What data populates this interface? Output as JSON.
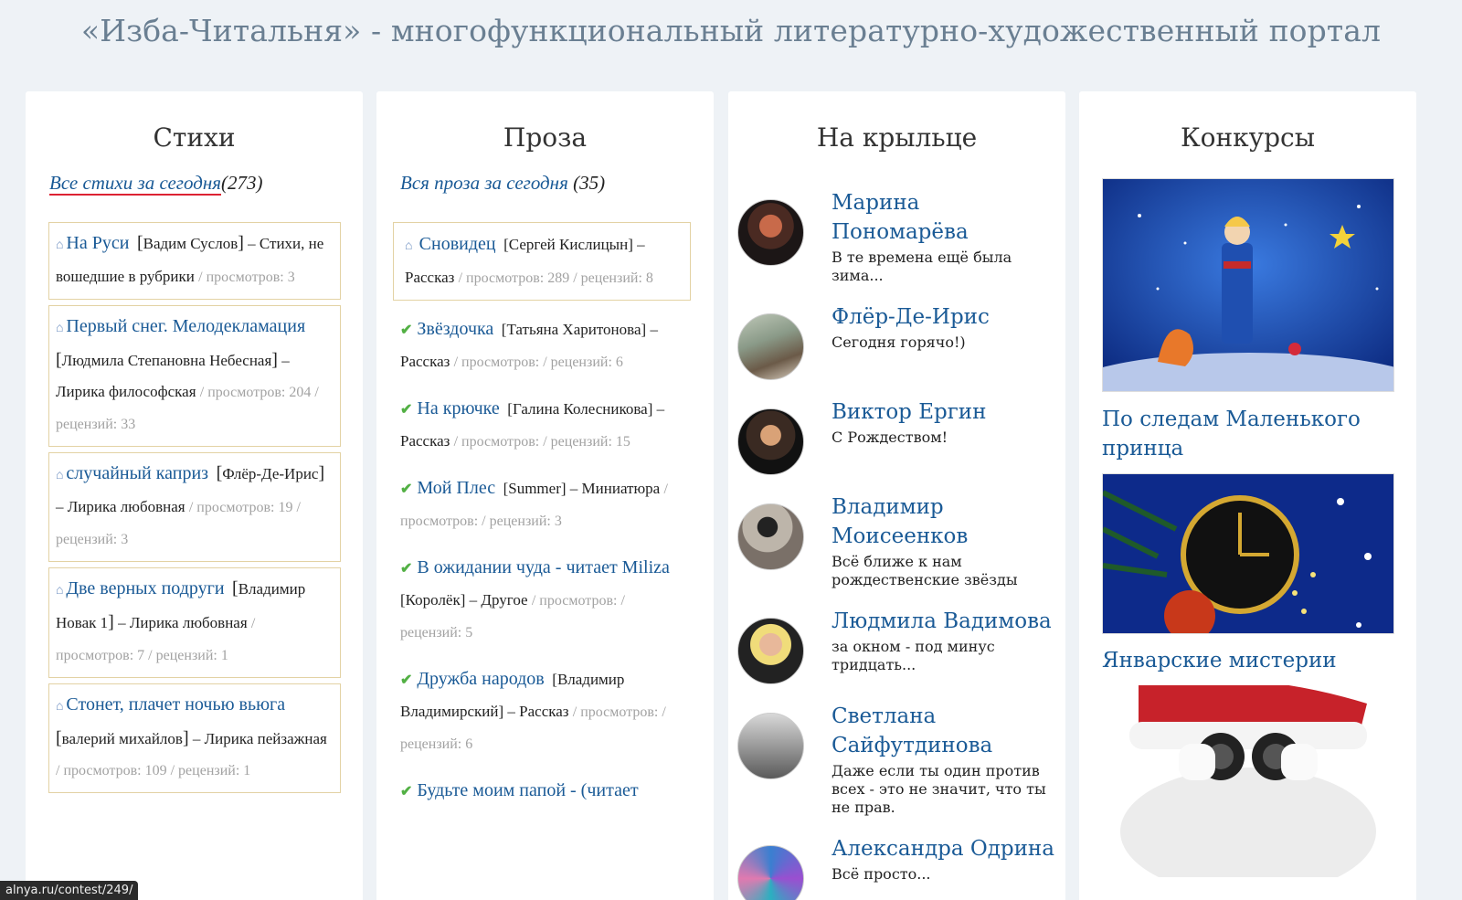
{
  "site": {
    "title": "«Изба-Читальня» - многофункциональный литературно-художественный портал"
  },
  "poems": {
    "heading": "Стихи",
    "all_link": "Все стихи за сегодня",
    "count": "(273)",
    "items": [
      {
        "title": "На Руси",
        "author": "Вадим Суслов",
        "rest": "– Стихи, не вошедшие в рубрики",
        "meta": "/ просмотров: 3"
      },
      {
        "title": "Первый снег. Мелодекламация",
        "author": "Людмила Степановна Небесная",
        "rest": "– Лирика философская",
        "meta": "/ просмотров: 204 / рецензий: 33"
      },
      {
        "title": "случайный каприз",
        "author": "Флёр-Де-Ирис",
        "rest": "– Лирика любовная",
        "meta": "/ просмотров: 19 / рецензий: 3"
      },
      {
        "title": "Две верных подруги",
        "author": "Владимир Новак 1",
        "rest": "– Лирика любовная",
        "meta": "/ просмотров: 7 / рецензий: 1"
      },
      {
        "title": "Стонет, плачет ночью вьюга",
        "author": "валерий михайлов",
        "rest": "– Лирика пейзажная",
        "meta": "/ просмотров: 109 / рецензий: 1"
      }
    ]
  },
  "prose": {
    "heading": "Проза",
    "all_link": "Вся проза за сегодня",
    "count": "(35)",
    "items": [
      {
        "title": "Сновидец",
        "author": "Сергей Кислицын",
        "rest": "– Рассказ",
        "meta": "/ просмотров: 289 / рецензий: 8"
      },
      {
        "title": "Звёздочка",
        "author": "Татьяна Харитонова",
        "rest": "– Рассказ",
        "meta": "/ просмотров: / рецензий: 6"
      },
      {
        "title": "На крючке",
        "author": "Галина Колесникова",
        "rest": "– Рассказ",
        "meta": "/ просмотров: / рецензий: 15"
      },
      {
        "title": "Мой Плес",
        "author": "Summer",
        "rest": "– Миниатюра",
        "meta": "/ просмотров: / рецензий: 3"
      },
      {
        "title": "В ожидании чуда - читает Miliza",
        "author": "Королёк",
        "rest": "– Другое",
        "meta": "/ просмотров: / рецензий: 5"
      },
      {
        "title": "Дружба народов",
        "author": "Владимир Владимирский",
        "rest": "– Рассказ",
        "meta": "/ просмотров: / рецензий: 6"
      },
      {
        "title": "Будьте моим папой - (читает",
        "author": "",
        "rest": "",
        "meta": ""
      }
    ]
  },
  "porch": {
    "heading": "На крыльце",
    "people": [
      {
        "name": "Марина Пономарёва",
        "msg": "В те времена ещё была зима..."
      },
      {
        "name": "Флёр-Де-Ирис",
        "msg": "Сегодня горячо!)"
      },
      {
        "name": "Виктор Ергин",
        "msg": "С Рождеством!"
      },
      {
        "name": "Владимир Моисеенков",
        "msg": "Всё ближе к нам рождественские звёзды"
      },
      {
        "name": "Людмила Вадимова",
        "msg": "за окном - под минус тридцать..."
      },
      {
        "name": "Светлана Сайфутдинова",
        "msg": "Даже если ты один против всех - это не значит, что ты не прав."
      },
      {
        "name": "Александра Одрина",
        "msg": "Всё просто..."
      }
    ]
  },
  "contests": {
    "heading": "Конкурсы",
    "items": [
      {
        "label": "По следам Маленького принца"
      },
      {
        "label": "Январские мистерии"
      },
      {
        "label": ""
      }
    ]
  },
  "status_bar": {
    "url": "alnya.ru/contest/249/"
  },
  "colors": {
    "link": "#1a5a96",
    "box_border": "#e3d2a4",
    "check": "#52b044",
    "meta": "#a2a2a2"
  }
}
